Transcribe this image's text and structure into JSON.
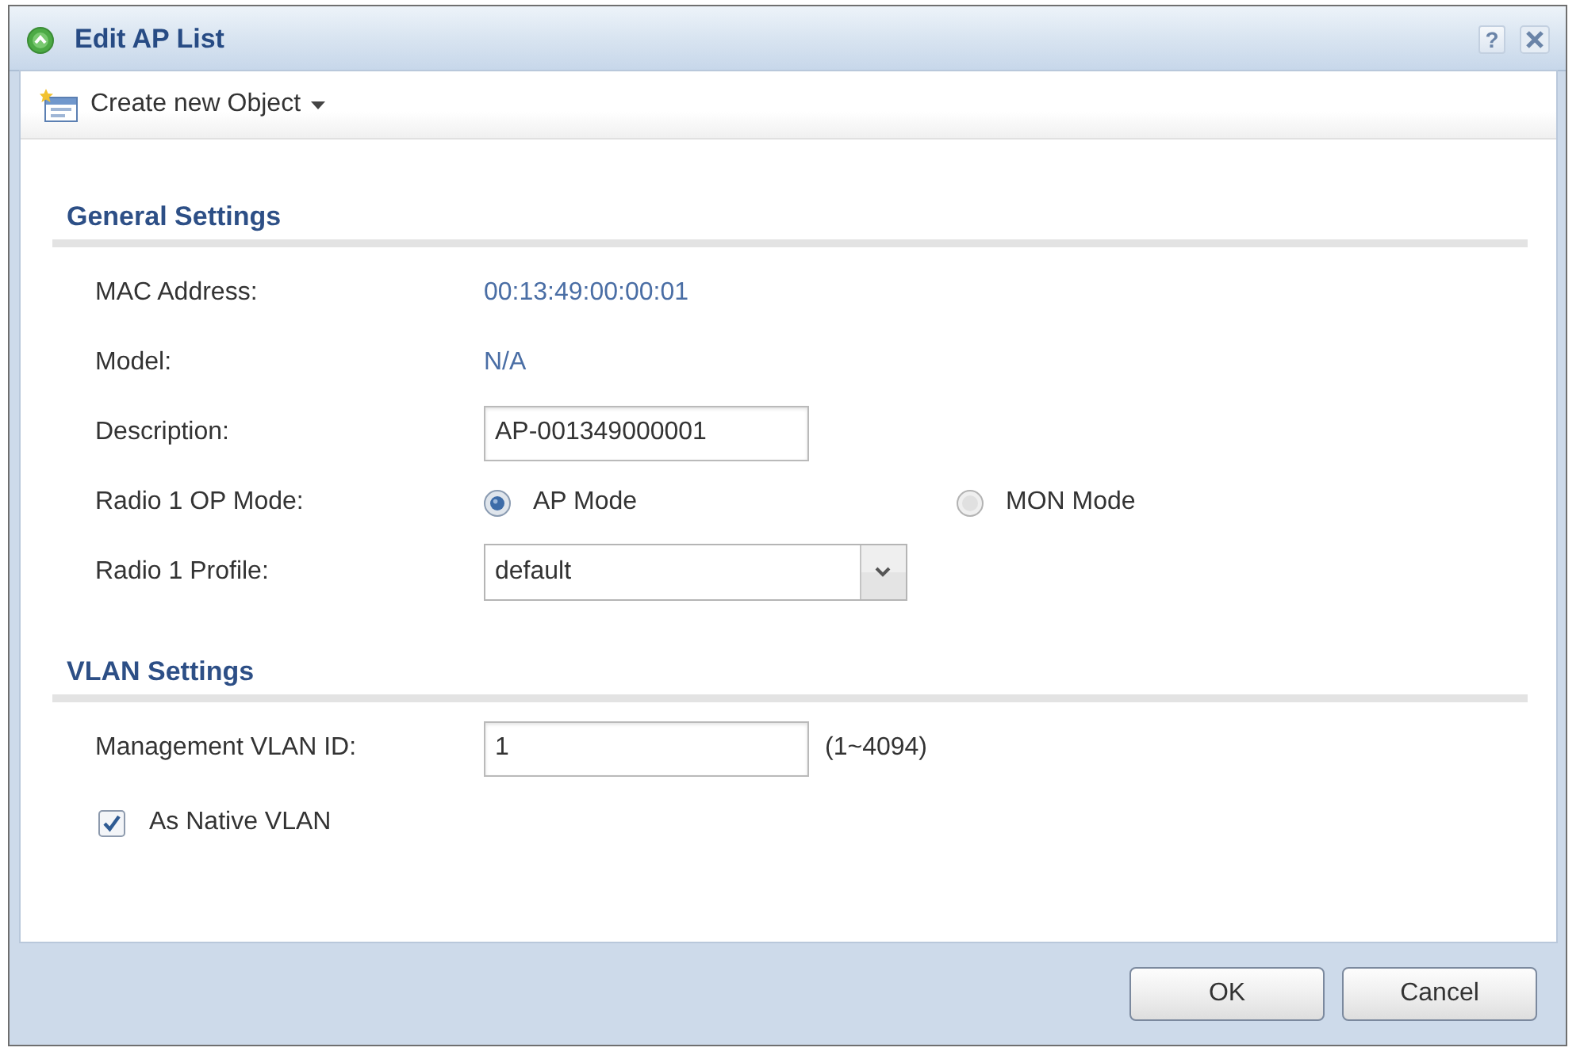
{
  "window": {
    "title": "Edit AP List",
    "help_button": "?"
  },
  "toolbar": {
    "create_menu": "Create new Object"
  },
  "sections": [
    {
      "title": "General Settings",
      "fields": [
        {
          "kind": "text",
          "label": "MAC Address:",
          "value": "00:13:49:00:00:01"
        },
        {
          "kind": "text",
          "label": "Model:",
          "value": "N/A"
        },
        {
          "kind": "input",
          "label": "Description:",
          "value": "AP-001349000001"
        },
        {
          "kind": "radio",
          "label": "Radio 1 OP Mode:",
          "options": [
            {
              "label": "AP Mode",
              "selected": true
            },
            {
              "label": "MON Mode",
              "selected": false
            }
          ]
        },
        {
          "kind": "select",
          "label": "Radio 1 Profile:",
          "value": "default"
        }
      ]
    },
    {
      "title": "VLAN Settings",
      "fields": [
        {
          "kind": "input",
          "label": "Management VLAN ID:",
          "value": "1",
          "hint": "(1~4094)"
        },
        {
          "kind": "checkbox",
          "label": "As Native VLAN",
          "checked": true
        }
      ]
    }
  ],
  "buttons": [
    {
      "label": "OK"
    },
    {
      "label": "Cancel"
    }
  ]
}
